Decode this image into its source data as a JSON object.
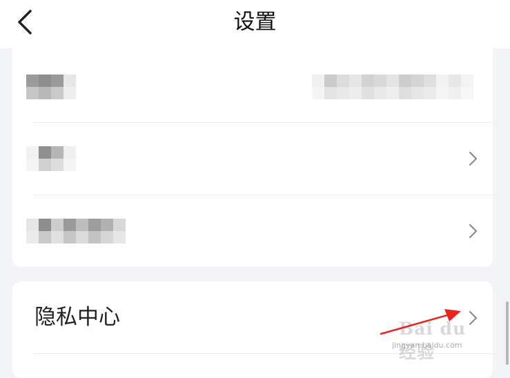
{
  "header": {
    "title": "设置",
    "back_icon": "chevron-left-icon"
  },
  "settings_rows": [
    {
      "label": "",
      "value": "",
      "blurred": true,
      "has_chevron": false
    },
    {
      "label": "",
      "blurred": true,
      "has_chevron": true
    },
    {
      "label": "",
      "blurred": true,
      "has_chevron": true
    }
  ],
  "privacy_center": {
    "label": "隐私中心",
    "chevron_icon": "chevron-right-icon"
  },
  "watermark": {
    "text": "Bai du 经验",
    "url": "jingyan.baidu.com"
  },
  "annotation": {
    "type": "red-arrow",
    "color": "#e8241c"
  },
  "colors": {
    "background": "#f2f3f7",
    "card": "#ffffff",
    "chevron": "#8a8a8a"
  }
}
